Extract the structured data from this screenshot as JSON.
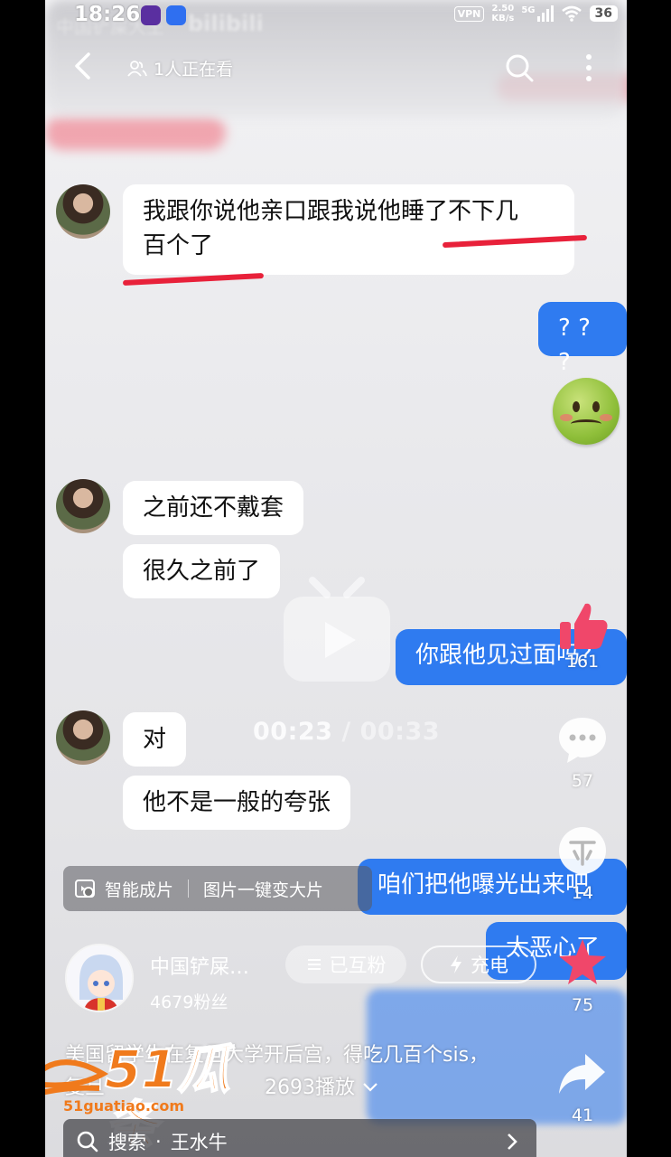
{
  "status_bar": {
    "time": "18:26",
    "vpn": "VPN",
    "speed_value": "2.50",
    "speed_unit": "KB/s",
    "network": "5G",
    "battery": "36"
  },
  "header": {
    "watch_text": "1人正在看",
    "faded_title": "中国铲屎大王",
    "faded_brand": "bilibili"
  },
  "chat": {
    "msg1": "我跟你说他亲口跟我说他睡了不下几百个了",
    "msg1_line1": "我跟你说他亲口跟我说他睡了不下几",
    "msg1_line2": "百个了",
    "reply_qqq": "? ? ?",
    "msg2": "之前还不戴套",
    "msg3": "很久之前了",
    "reply_met": "你跟他见过面吗?",
    "msg4": "对",
    "msg5": "他不是一般的夸张",
    "reply_expose": "咱们把他曝光出来吧",
    "reply_gross": "太恶心了"
  },
  "video": {
    "current_time": "00:23",
    "separator": " / ",
    "total_time": "00:33"
  },
  "actions": {
    "likes": "161",
    "comments": "57",
    "coins": "14",
    "favorites": "75",
    "shares": "41"
  },
  "smart_chip": {
    "label1": "智能成片",
    "label2": "图片一键变大片"
  },
  "author": {
    "name": "中国铲屎…",
    "fans": "4679粉丝",
    "follow_status": "已互粉",
    "charge": "充电"
  },
  "description": {
    "title": "美国留学生在复旦大学开后宫，得吃几百个sis，",
    "subline_prefix": "复旦",
    "plays": "2693播放"
  },
  "watermark": {
    "brand": "51瓜条",
    "url": "51guatiao.com"
  },
  "search": {
    "label": "搜索",
    "dot": "·",
    "query": "王水牛"
  },
  "colors": {
    "bubble_blue": "#2f7bf0",
    "underline_red": "#e8213a",
    "like_pink": "#f0476a",
    "watermark_orange": "#f07a1c"
  }
}
